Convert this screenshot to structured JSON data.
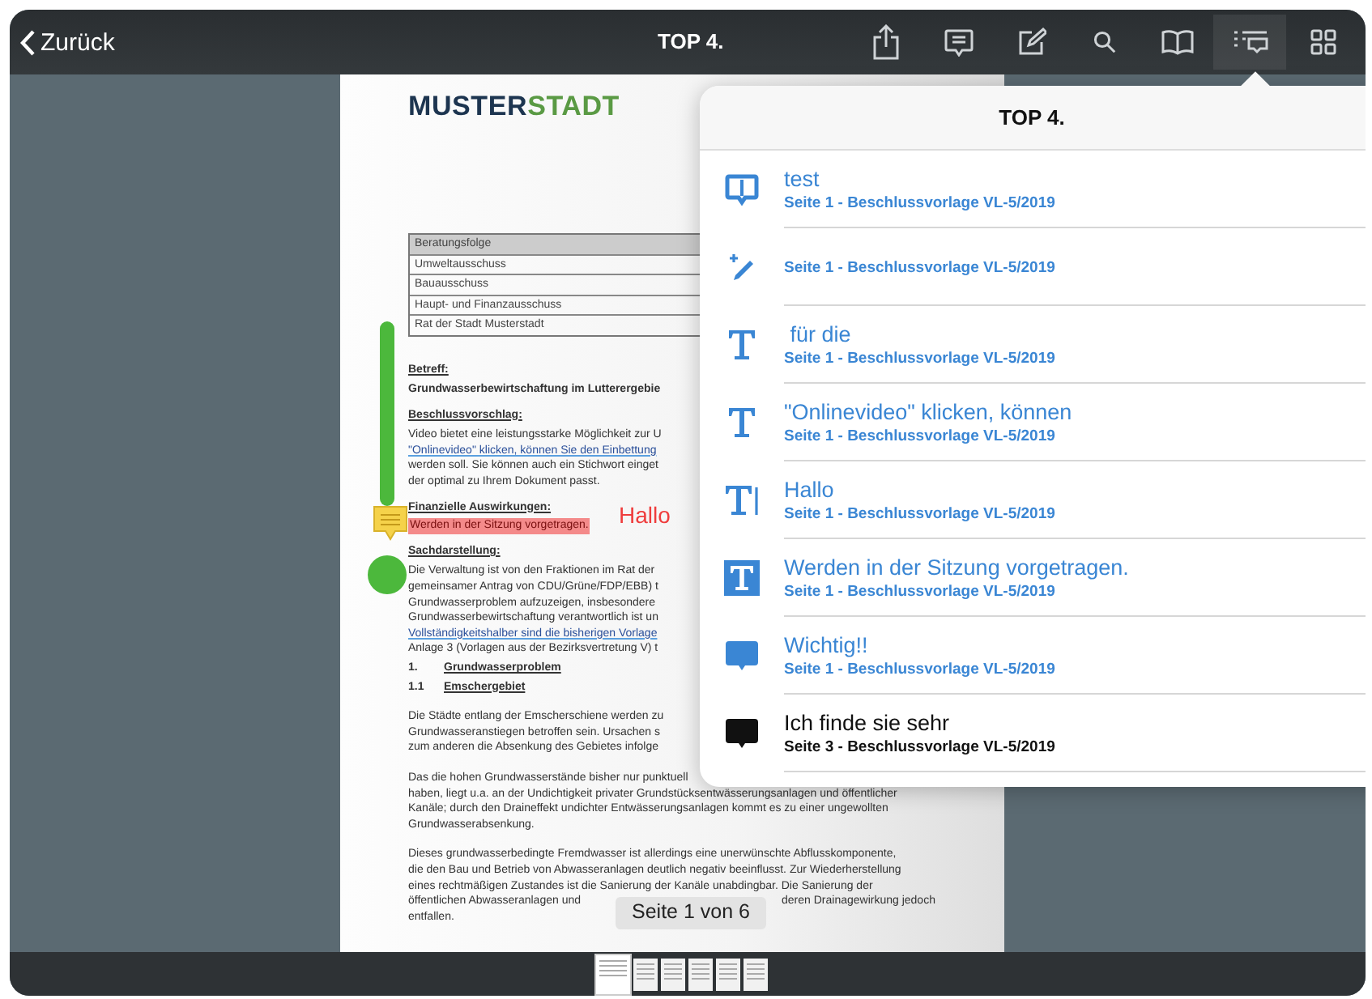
{
  "toolbar": {
    "back": "Zurück",
    "title": "TOP 4.",
    "tools": [
      {
        "kind": "share",
        "selected": false
      },
      {
        "kind": "comment",
        "selected": false
      },
      {
        "kind": "edit",
        "selected": false
      },
      {
        "kind": "search",
        "selected": false
      },
      {
        "kind": "book",
        "selected": false
      },
      {
        "kind": "annotations",
        "selected": true
      },
      {
        "kind": "grid",
        "selected": false
      }
    ]
  },
  "document": {
    "logo": [
      "MUSTER",
      "STADT"
    ],
    "table_rows": [
      {
        "text": "Beratungsfolge",
        "header": true
      },
      {
        "text": "Umweltausschuss",
        "header": false
      },
      {
        "text": "Bauausschuss",
        "header": false
      },
      {
        "text": "Haupt- und Finanzausschuss",
        "header": false
      },
      {
        "text": "Rat der Stadt Musterstadt",
        "header": false
      }
    ],
    "blocks": [
      {
        "kind": "heading",
        "text": "Betreff:"
      },
      {
        "kind": "bold",
        "text": "Grundwasserbewirtschaftung im Lutterergebie"
      },
      {
        "kind": "heading",
        "text": "Beschlussvorschlag:"
      },
      {
        "kind": "lines",
        "lines": [
          {
            "text": "Video bietet eine leistungsstarke Möglichkeit zur U",
            "underlined": false
          },
          {
            "text": "\"Onlinevideo\" klicken, können Sie den Einbettung",
            "underlined": true
          },
          {
            "text": "werden soll. Sie können auch ein Stichwort einget",
            "underlined": false
          },
          {
            "text": "der optimal zu Ihrem Dokument passt.",
            "underlined": false
          }
        ]
      },
      {
        "kind": "heading",
        "text": "Finanzielle Auswirkungen:"
      },
      {
        "kind": "highlight",
        "text": "Werden in der Sitzung  vorgetragen."
      },
      {
        "kind": "heading",
        "text": "Sachdarstellung:"
      },
      {
        "kind": "lines",
        "lines": [
          {
            "text": "Die Verwaltung ist von den Fraktionen im Rat der",
            "underlined": false
          },
          {
            "text": "gemeinsamer Antrag von CDU/Grüne/FDP/EBB) t",
            "underlined": false
          },
          {
            "text": "Grundwasserproblem aufzuzeigen, insbesondere",
            "underlined": false
          },
          {
            "text": "Grundwasserbewirtschaftung verantwortlich ist un",
            "underlined": false
          },
          {
            "text": "Vollständigkeitshalber sind die bisherigen Vorlage",
            "underlined": true
          },
          {
            "text": "Anlage 3 (Vorlagen aus der Bezirksvertretung V) t",
            "underlined": false
          }
        ]
      },
      {
        "kind": "numbered",
        "number": "1.",
        "text": "Grundwasserproblem"
      },
      {
        "kind": "numbered",
        "number": "1.1",
        "text": "Emschergebiet"
      },
      {
        "kind": "lines",
        "lines": [
          {
            "text": "Die Städte entlang der Emscherschiene werden zu",
            "underlined": false
          },
          {
            "text": "Grundwasseranstiegen betroffen sein. Ursachen s",
            "underlined": false
          },
          {
            "text": "zum anderen die Absenkung des Gebietes infolge",
            "underlined": false
          }
        ]
      },
      {
        "kind": "lines",
        "lines": [
          {
            "text": "Das die hohen Grundwasserstände bisher nur punktuell",
            "underlined": false
          },
          {
            "text": "haben, liegt u.a. an der Undichtigkeit privater Grundstücksentwässerungsanlagen und öffentlicher",
            "underlined": false
          },
          {
            "text": "Kanäle; durch den Draineffekt undichter Entwässerungsanlagen kommt es zu einer ungewollten",
            "underlined": false
          },
          {
            "text": "Grundwasserabsenkung.",
            "underlined": false
          }
        ]
      },
      {
        "kind": "lines",
        "lines": [
          {
            "text": "Dieses grundwasserbedingte Fremdwasser ist allerdings eine unerwünschte Abflusskomponente,",
            "underlined": false
          },
          {
            "text": "die den Bau und Betrieb von Abwasseranlagen deutlich negativ beeinflusst. Zur Wiederherstellung",
            "underlined": false
          },
          {
            "text": "eines rechtmäßigen Zustandes ist die Sanierung der Kanäle unabdingbar. Die Sanierung der",
            "underlined": false
          },
          {
            "text": "öffentlichen Abwasseranlagen und",
            "after": "deren Drainagewirkung jedoch",
            "underlined": false
          },
          {
            "text": "entfallen.",
            "underlined": false
          }
        ]
      }
    ],
    "free_text": "Hallo"
  },
  "page_indicator": "Seite 1 von 6",
  "thumbnails": [
    {
      "selected": true
    },
    {
      "selected": false
    },
    {
      "selected": false
    },
    {
      "selected": false
    },
    {
      "selected": false
    },
    {
      "selected": false
    }
  ],
  "popover": {
    "title": "TOP 4.",
    "items": [
      {
        "kind": "comment",
        "title": "test",
        "subtitle": "Seite 1 - Beschlussvorlage VL-5/2019",
        "color": "#3a86d4"
      },
      {
        "kind": "pen",
        "subtitle": "Seite 1 - Beschlussvorlage VL-5/2019",
        "color": "#3a86d4"
      },
      {
        "kind": "text",
        "title": " für die",
        "subtitle": "Seite 1 - Beschlussvorlage VL-5/2019",
        "color": "#3a86d4"
      },
      {
        "kind": "text",
        "title": "\"Onlinevideo\" klicken, können",
        "subtitle": "Seite 1 - Beschlussvorlage VL-5/2019",
        "color": "#3a86d4"
      },
      {
        "kind": "freetext",
        "title": "Hallo",
        "subtitle": "Seite 1 - Beschlussvorlage VL-5/2019",
        "color": "#3a86d4"
      },
      {
        "kind": "textbox",
        "title": "Werden in der Sitzung vorgetragen.",
        "subtitle": "Seite 1 - Beschlussvorlage VL-5/2019",
        "color": "#3a86d4"
      },
      {
        "kind": "note",
        "title": "Wichtig!!",
        "subtitle": "Seite 1 - Beschlussvorlage VL-5/2019",
        "color": "#3a86d4"
      },
      {
        "kind": "note",
        "title": "Ich finde sie sehr",
        "subtitle": "Seite 3 - Beschlussvorlage VL-5/2019",
        "color": "#111111"
      }
    ]
  }
}
